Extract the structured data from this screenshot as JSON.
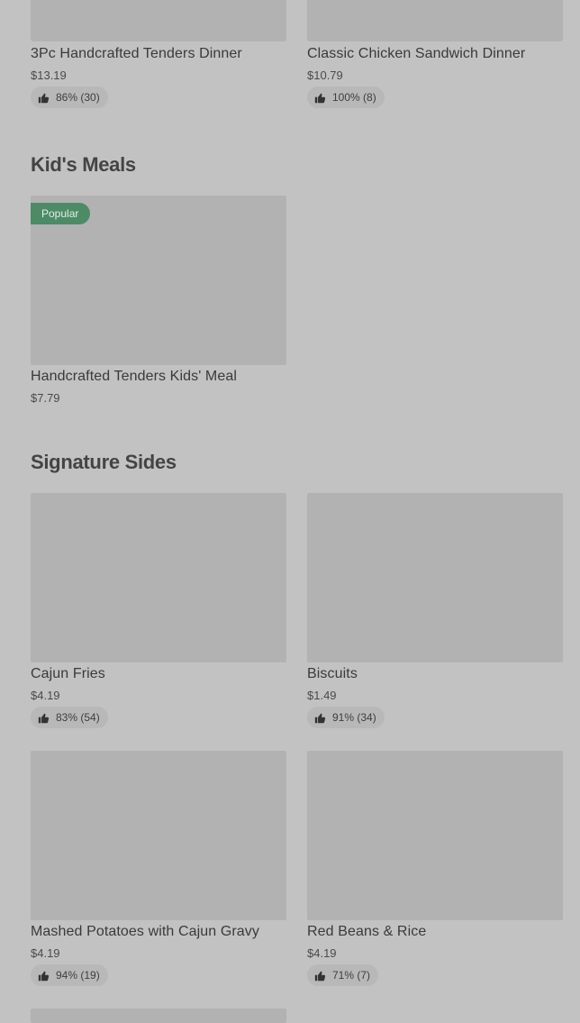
{
  "top_row": [
    {
      "name": "3Pc Handcrafted Tenders Dinner",
      "price": "$13.19",
      "rating": "86% (30)"
    },
    {
      "name": "Classic Chicken Sandwich Dinner",
      "price": "$10.79",
      "rating": "100% (8)"
    }
  ],
  "kids_meals": {
    "title": "Kid's Meals",
    "items": [
      {
        "name": "Handcrafted Tenders Kids' Meal",
        "price": "$7.79",
        "badge": "Popular"
      }
    ]
  },
  "signature_sides": {
    "title": "Signature Sides",
    "items": [
      {
        "name": "Cajun Fries",
        "price": "$4.19",
        "rating": "83% (54)"
      },
      {
        "name": "Biscuits",
        "price": "$1.49",
        "rating": "91% (34)"
      },
      {
        "name": "Mashed Potatoes with Cajun Gravy",
        "price": "$4.19",
        "rating": "94% (19)"
      },
      {
        "name": "Red Beans & Rice",
        "price": "$4.19",
        "rating": "71% (7)"
      }
    ]
  },
  "colors": {
    "badge": "#4d8a66",
    "background": "#c2c2c2",
    "placeholder": "#b2b2b2"
  },
  "icons": {
    "rating": "thumbs-up-icon"
  }
}
